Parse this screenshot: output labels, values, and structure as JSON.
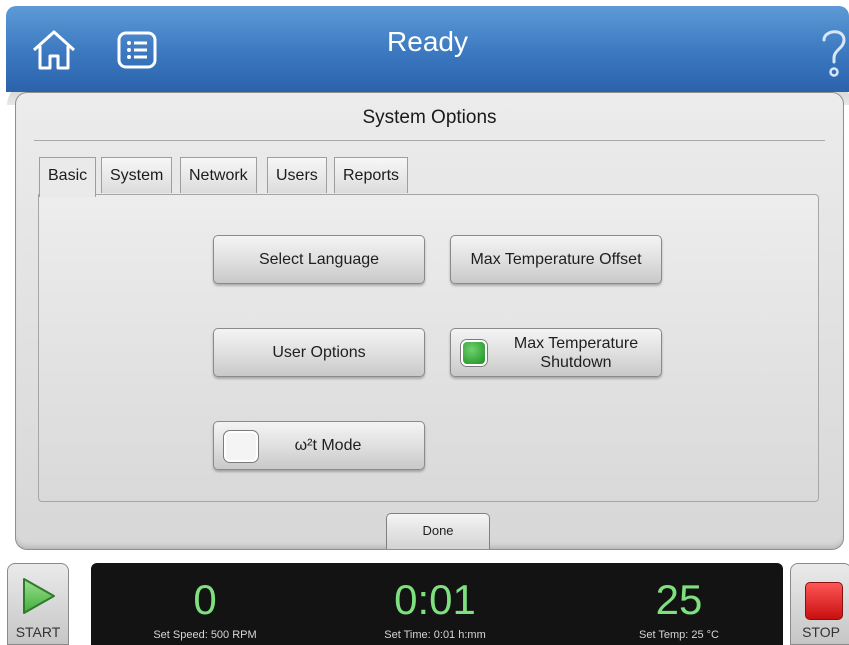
{
  "topbar": {
    "title": "Ready",
    "home_icon": "home-icon",
    "list_icon": "list-icon",
    "help_icon": "question-mark-icon"
  },
  "dialog": {
    "title": "System Options",
    "tabs": [
      {
        "label": "Basic",
        "active": true
      },
      {
        "label": "System",
        "active": false
      },
      {
        "label": "Network",
        "active": false
      },
      {
        "label": "Users",
        "active": false
      },
      {
        "label": "Reports",
        "active": false
      }
    ],
    "buttons": {
      "select_language": "Select Language",
      "max_temperature_offset": "Max Temperature Offset",
      "user_options": "User Options",
      "max_temperature_shutdown_line1": "Max Temperature",
      "max_temperature_shutdown_line2": "Shutdown",
      "max_temperature_shutdown_state": "on",
      "omega_mode": "ω²t Mode",
      "omega_mode_state": "off"
    },
    "done": "Done"
  },
  "controls": {
    "start_label": "START",
    "stop_label": "STOP"
  },
  "status": {
    "speed_value": "0",
    "speed_caption": "Set Speed: 500 RPM",
    "time_value": "0:01",
    "time_caption": "Set Time: 0:01 h:mm",
    "temp_value": "25",
    "temp_caption": "Set Temp: 25 °C"
  },
  "colors": {
    "header_blue": "#3b78c0",
    "status_green": "#7ee07e",
    "stop_red": "#e02020",
    "start_green": "#3fae3a"
  }
}
